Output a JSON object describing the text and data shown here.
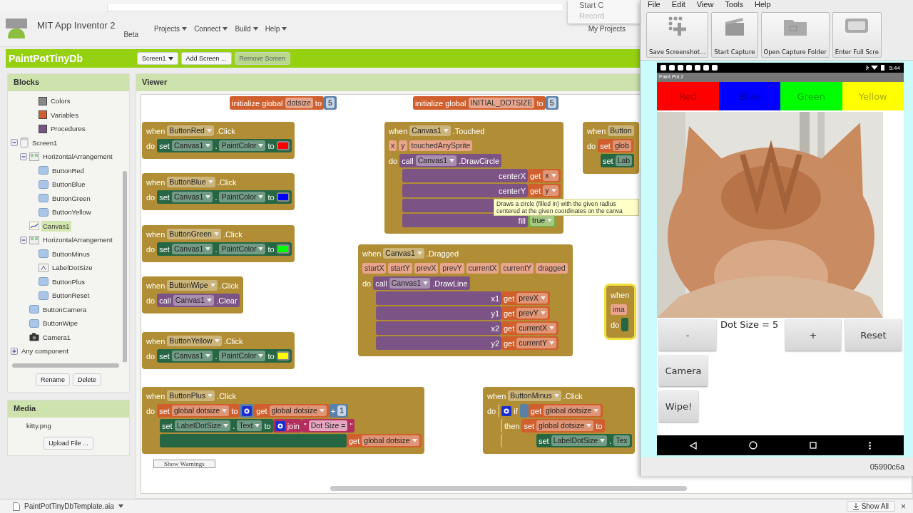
{
  "browser": {
    "menu_items": [
      {
        "label": "Start C",
        "disabled": false
      },
      {
        "label": "Record",
        "disabled": true
      }
    ]
  },
  "header": {
    "app_name": "MIT App Inventor 2",
    "edition": "Beta",
    "menus": [
      "Projects",
      "Connect",
      "Build",
      "Help"
    ],
    "my_projects": "My Projects"
  },
  "project_bar": {
    "project": "PaintPotTinyDb",
    "buttons": [
      {
        "label": "Screen1",
        "kind": "dropdown",
        "disabled": false
      },
      {
        "label": "Add Screen ...",
        "kind": "plain",
        "disabled": false
      },
      {
        "label": "Remove Screen",
        "kind": "plain",
        "disabled": true
      }
    ]
  },
  "blocks_panel": {
    "title": "Blocks",
    "tree": [
      {
        "label": "Colors",
        "kind": "builtin",
        "color": "#888888",
        "selected": false
      },
      {
        "label": "Variables",
        "kind": "builtin",
        "color": "#d05f2d",
        "selected": false
      },
      {
        "label": "Procedures",
        "kind": "builtin",
        "color": "#7c5385",
        "selected": false
      },
      {
        "label": "Screen1",
        "kind": "screen",
        "selected": false,
        "expanded": true,
        "children": [
          {
            "label": "HorizontalArrangement",
            "kind": "arrangement",
            "selected": false,
            "expanded": true,
            "children": [
              {
                "label": "ButtonRed",
                "kind": "button",
                "selected": false
              },
              {
                "label": "ButtonBlue",
                "kind": "button",
                "selected": false
              },
              {
                "label": "ButtonGreen",
                "kind": "button",
                "selected": false
              },
              {
                "label": "ButtonYellow",
                "kind": "button",
                "selected": false
              }
            ]
          },
          {
            "label": "Canvas1",
            "kind": "canvas",
            "selected": true
          },
          {
            "label": "HorizontalArrangement",
            "kind": "arrangement",
            "selected": false,
            "expanded": true,
            "children": [
              {
                "label": "ButtonMinus",
                "kind": "button",
                "selected": false
              },
              {
                "label": "LabelDotSize",
                "kind": "label",
                "selected": false
              },
              {
                "label": "ButtonPlus",
                "kind": "button",
                "selected": false
              },
              {
                "label": "ButtonReset",
                "kind": "button",
                "selected": false
              }
            ]
          },
          {
            "label": "ButtonCamera",
            "kind": "button",
            "selected": false
          },
          {
            "label": "ButtonWipe",
            "kind": "button",
            "selected": false
          },
          {
            "label": "Camera1",
            "kind": "camera",
            "selected": false
          }
        ]
      },
      {
        "label": "Any component",
        "kind": "group",
        "selected": false,
        "expanded": false
      }
    ],
    "buttons": [
      "Rename",
      "Delete"
    ]
  },
  "media_panel": {
    "title": "Media",
    "files": [
      "kitty.png"
    ],
    "upload_button": "Upload File ..."
  },
  "viewer": {
    "title": "Viewer",
    "blocks": [
      {
        "kind": "init",
        "selected": false,
        "lines": [
          [
            {
              "kind": "var",
              "chips": [
                {
                  "kind": "word",
                  "text": "initialize global"
                },
                {
                  "kind": "param",
                  "text": "dotsize"
                },
                {
                  "kind": "word",
                  "text": "to"
                }
              ]
            },
            {
              "kind": "math",
              "chips": [
                {
                  "kind": "num",
                  "text": "5"
                }
              ]
            }
          ]
        ]
      },
      {
        "kind": "init",
        "selected": false,
        "lines": [
          [
            {
              "kind": "var",
              "chips": [
                {
                  "kind": "word",
                  "text": "initialize global"
                },
                {
                  "kind": "param",
                  "text": "INITIAL_DOTSIZE"
                },
                {
                  "kind": "word",
                  "text": "to"
                }
              ]
            },
            {
              "kind": "math",
              "chips": [
                {
                  "kind": "num",
                  "text": "5"
                }
              ]
            }
          ]
        ]
      },
      {
        "kind": "event",
        "selected": false,
        "lines": [
          [
            {
              "kind": "event",
              "chips": [
                {
                  "kind": "word",
                  "text": "when"
                },
                {
                  "kind": "dd",
                  "text": "ButtonRed"
                },
                {
                  "kind": "word",
                  "text": ".Click"
                }
              ]
            }
          ],
          [
            {
              "kind": "event",
              "chips": [
                {
                  "kind": "word",
                  "text": "do"
                }
              ]
            },
            {
              "kind": "set",
              "chips": [
                {
                  "kind": "word",
                  "text": "set"
                },
                {
                  "kind": "dd",
                  "text": "Canvas1"
                },
                {
                  "kind": "word",
                  "text": "."
                },
                {
                  "kind": "dd",
                  "text": "PaintColor"
                },
                {
                  "kind": "word",
                  "text": "to"
                },
                {
                  "kind": "swatch",
                  "color": "#ff0000"
                }
              ]
            }
          ]
        ]
      },
      {
        "kind": "event",
        "selected": false,
        "lines": [
          [
            {
              "kind": "event",
              "chips": [
                {
                  "kind": "word",
                  "text": "when"
                },
                {
                  "kind": "dd",
                  "text": "ButtonBlue"
                },
                {
                  "kind": "word",
                  "text": ".Click"
                }
              ]
            }
          ],
          [
            {
              "kind": "event",
              "chips": [
                {
                  "kind": "word",
                  "text": "do"
                }
              ]
            },
            {
              "kind": "set",
              "chips": [
                {
                  "kind": "word",
                  "text": "set"
                },
                {
                  "kind": "dd",
                  "text": "Canvas1"
                },
                {
                  "kind": "word",
                  "text": "."
                },
                {
                  "kind": "dd",
                  "text": "PaintColor"
                },
                {
                  "kind": "word",
                  "text": "to"
                },
                {
                  "kind": "swatch",
                  "color": "#0000ff"
                }
              ]
            }
          ]
        ]
      },
      {
        "kind": "event",
        "selected": false,
        "lines": [
          [
            {
              "kind": "event",
              "chips": [
                {
                  "kind": "word",
                  "text": "when"
                },
                {
                  "kind": "dd",
                  "text": "ButtonGreen"
                },
                {
                  "kind": "word",
                  "text": ".Click"
                }
              ]
            }
          ],
          [
            {
              "kind": "event",
              "chips": [
                {
                  "kind": "word",
                  "text": "do"
                }
              ]
            },
            {
              "kind": "set",
              "chips": [
                {
                  "kind": "word",
                  "text": "set"
                },
                {
                  "kind": "dd",
                  "text": "Canvas1"
                },
                {
                  "kind": "word",
                  "text": "."
                },
                {
                  "kind": "dd",
                  "text": "PaintColor"
                },
                {
                  "kind": "word",
                  "text": "to"
                },
                {
                  "kind": "swatch",
                  "color": "#00ff00"
                }
              ]
            }
          ]
        ]
      },
      {
        "kind": "event",
        "selected": false,
        "lines": [
          [
            {
              "kind": "event",
              "chips": [
                {
                  "kind": "word",
                  "text": "when"
                },
                {
                  "kind": "dd",
                  "text": "ButtonWipe"
                },
                {
                  "kind": "word",
                  "text": ".Click"
                }
              ]
            }
          ],
          [
            {
              "kind": "event",
              "chips": [
                {
                  "kind": "word",
                  "text": "do"
                }
              ]
            },
            {
              "kind": "call",
              "chips": [
                {
                  "kind": "word",
                  "text": "call"
                },
                {
                  "kind": "dd",
                  "text": "Canvas1"
                },
                {
                  "kind": "word",
                  "text": ".Clear"
                }
              ]
            }
          ]
        ]
      },
      {
        "kind": "event",
        "selected": false,
        "lines": [
          [
            {
              "kind": "event",
              "chips": [
                {
                  "kind": "word",
                  "text": "when"
                },
                {
                  "kind": "dd",
                  "text": "ButtonYellow"
                },
                {
                  "kind": "word",
                  "text": ".Click"
                }
              ]
            }
          ],
          [
            {
              "kind": "event",
              "chips": [
                {
                  "kind": "word",
                  "text": "do"
                }
              ]
            },
            {
              "kind": "set",
              "chips": [
                {
                  "kind": "word",
                  "text": "set"
                },
                {
                  "kind": "dd",
                  "text": "Canvas1"
                },
                {
                  "kind": "word",
                  "text": "."
                },
                {
                  "kind": "dd",
                  "text": "PaintColor"
                },
                {
                  "kind": "word",
                  "text": "to"
                },
                {
                  "kind": "swatch",
                  "color": "#ffff00"
                }
              ]
            }
          ]
        ]
      },
      {
        "kind": "event",
        "selected": false,
        "lines": [
          [
            {
              "kind": "event",
              "chips": [
                {
                  "kind": "word",
                  "text": "when"
                },
                {
                  "kind": "dd",
                  "text": "Canvas1"
                },
                {
                  "kind": "word",
                  "text": ".Touched"
                }
              ]
            }
          ],
          [
            {
              "kind": "event",
              "chips": [
                {
                  "kind": "param",
                  "text": "x"
                },
                {
                  "kind": "param",
                  "text": "y"
                },
                {
                  "kind": "param",
                  "text": "touchedAnySprite"
                }
              ]
            }
          ],
          [
            {
              "kind": "event",
              "chips": [
                {
                  "kind": "word",
                  "text": "do"
                }
              ]
            },
            {
              "kind": "call",
              "chips": [
                {
                  "kind": "word",
                  "text": "call"
                },
                {
                  "kind": "dd",
                  "text": "Canvas1"
                },
                {
                  "kind": "word",
                  "text": ".DrawCircle"
                }
              ]
            }
          ],
          [
            {
              "kind": "arg",
              "chips": [
                {
                  "kind": "word",
                  "text": "centerX"
                }
              ]
            },
            {
              "kind": "get",
              "chips": [
                {
                  "kind": "word",
                  "text": "get"
                },
                {
                  "kind": "dd",
                  "text": "x"
                }
              ]
            }
          ],
          [
            {
              "kind": "arg",
              "chips": [
                {
                  "kind": "word",
                  "text": "centerY"
                }
              ]
            },
            {
              "kind": "get",
              "chips": [
                {
                  "kind": "word",
                  "text": "get"
                },
                {
                  "kind": "dd",
                  "text": "y"
                }
              ]
            }
          ],
          [
            {
              "kind": "arg"
            }
          ],
          [
            {
              "kind": "arg",
              "chips": [
                {
                  "kind": "word",
                  "text": "fill"
                }
              ]
            },
            {
              "kind": "logic",
              "chips": [
                {
                  "kind": "dd",
                  "text": "true"
                }
              ]
            }
          ]
        ]
      },
      {
        "kind": "event",
        "selected": false,
        "lines": [
          [
            {
              "kind": "event",
              "chips": [
                {
                  "kind": "word",
                  "text": "when"
                },
                {
                  "kind": "field",
                  "text": "Button"
                }
              ]
            }
          ],
          [
            {
              "kind": "event",
              "chips": [
                {
                  "kind": "word",
                  "text": "do"
                }
              ]
            },
            {
              "kind": "varset",
              "chips": [
                {
                  "kind": "word",
                  "text": "set"
                },
                {
                  "kind": "field",
                  "text": "glob"
                }
              ]
            }
          ],
          [
            {
              "kind": "set",
              "chips": [
                {
                  "kind": "word",
                  "text": "set"
                },
                {
                  "kind": "field",
                  "text": "Lab"
                }
              ]
            }
          ]
        ]
      },
      {
        "kind": "event",
        "selected": false,
        "lines": [
          [
            {
              "kind": "event",
              "chips": [
                {
                  "kind": "word",
                  "text": "when"
                },
                {
                  "kind": "dd",
                  "text": "Canvas1"
                },
                {
                  "kind": "word",
                  "text": ".Dragged"
                }
              ]
            }
          ],
          [
            {
              "kind": "event",
              "chips": [
                {
                  "kind": "param",
                  "text": "startX"
                },
                {
                  "kind": "param",
                  "text": "startY"
                },
                {
                  "kind": "param",
                  "text": "prevX"
                },
                {
                  "kind": "param",
                  "text": "prevY"
                },
                {
                  "kind": "param",
                  "text": "currentX"
                },
                {
                  "kind": "param",
                  "text": "currentY"
                },
                {
                  "kind": "param",
                  "text": "dragged"
                }
              ]
            }
          ],
          [
            {
              "kind": "event",
              "chips": [
                {
                  "kind": "word",
                  "text": "do"
                }
              ]
            },
            {
              "kind": "call",
              "chips": [
                {
                  "kind": "word",
                  "text": "call"
                },
                {
                  "kind": "dd",
                  "text": "Canvas1"
                },
                {
                  "kind": "word",
                  "text": ".DrawLine"
                }
              ]
            }
          ],
          [
            {
              "kind": "arg",
              "chips": [
                {
                  "kind": "word",
                  "text": "x1"
                }
              ]
            },
            {
              "kind": "get",
              "chips": [
                {
                  "kind": "word",
                  "text": "get"
                },
                {
                  "kind": "dd",
                  "text": "prevX"
                }
              ]
            }
          ],
          [
            {
              "kind": "arg",
              "chips": [
                {
                  "kind": "word",
                  "text": "y1"
                }
              ]
            },
            {
              "kind": "get",
              "chips": [
                {
                  "kind": "word",
                  "text": "get"
                },
                {
                  "kind": "dd",
                  "text": "prevY"
                }
              ]
            }
          ],
          [
            {
              "kind": "arg",
              "chips": [
                {
                  "kind": "word",
                  "text": "x2"
                }
              ]
            },
            {
              "kind": "get",
              "chips": [
                {
                  "kind": "word",
                  "text": "get"
                },
                {
                  "kind": "dd",
                  "text": "currentX"
                }
              ]
            }
          ],
          [
            {
              "kind": "arg",
              "chips": [
                {
                  "kind": "word",
                  "text": "y2"
                }
              ]
            },
            {
              "kind": "get",
              "chips": [
                {
                  "kind": "word",
                  "text": "get"
                },
                {
                  "kind": "dd",
                  "text": "currentY"
                }
              ]
            }
          ]
        ]
      },
      {
        "kind": "event",
        "selected": true,
        "lines": [
          [
            {
              "kind": "event",
              "chips": [
                {
                  "kind": "word",
                  "text": "when"
                }
              ]
            }
          ],
          [
            {
              "kind": "event",
              "chips": [
                {
                  "kind": "param",
                  "text": "ima"
                }
              ]
            }
          ],
          [
            {
              "kind": "event",
              "chips": [
                {
                  "kind": "word",
                  "text": "do"
                }
              ]
            },
            {
              "kind": "set"
            }
          ]
        ]
      },
      {
        "kind": "event",
        "selected": false,
        "lines": [
          [
            {
              "kind": "event",
              "chips": [
                {
                  "kind": "word",
                  "text": "when"
                },
                {
                  "kind": "dd",
                  "text": "ButtonPlus"
                },
                {
                  "kind": "word",
                  "text": ".Click"
                }
              ]
            }
          ],
          [
            {
              "kind": "event",
              "chips": [
                {
                  "kind": "word",
                  "text": "do"
                }
              ]
            },
            {
              "kind": "varset",
              "chips": [
                {
                  "kind": "word",
                  "text": "set"
                },
                {
                  "kind": "dd",
                  "text": "global dotsize"
                },
                {
                  "kind": "word",
                  "text": "to"
                }
              ]
            },
            {
              "kind": "math",
              "chips": [
                {
                  "kind": "gear"
                }
              ]
            },
            {
              "kind": "get",
              "chips": [
                {
                  "kind": "word",
                  "text": "get"
                },
                {
                  "kind": "dd",
                  "text": "global dotsize"
                }
              ]
            },
            {
              "kind": "math",
              "chips": [
                {
                  "kind": "word",
                  "text": "+"
                },
                {
                  "kind": "num",
                  "text": "1"
                }
              ]
            }
          ],
          [
            {
              "kind": "set",
              "chips": [
                {
                  "kind": "word",
                  "text": "set"
                },
                {
                  "kind": "dd",
                  "text": "LabelDotSize"
                },
                {
                  "kind": "word",
                  "text": "."
                },
                {
                  "kind": "dd",
                  "text": "Text"
                },
                {
                  "kind": "word",
                  "text": "to"
                }
              ]
            },
            {
              "kind": "text",
              "chips": [
                {
                  "kind": "gear"
                },
                {
                  "kind": "word",
                  "text": "join"
                }
              ]
            },
            {
              "kind": "text",
              "chips": [
                {
                  "kind": "word",
                  "text": "\""
                },
                {
                  "kind": "str",
                  "text": "Dot Size ="
                },
                {
                  "kind": "word",
                  "text": "\""
                }
              ]
            }
          ],
          [
            {
              "kind": "set"
            },
            {
              "kind": "get",
              "chips": [
                {
                  "kind": "word",
                  "text": "get"
                },
                {
                  "kind": "dd",
                  "text": "global dotsize"
                }
              ]
            }
          ]
        ]
      },
      {
        "kind": "event",
        "selected": false,
        "lines": [
          [
            {
              "kind": "event",
              "chips": [
                {
                  "kind": "word",
                  "text": "when"
                },
                {
                  "kind": "dd",
                  "text": "ButtonMinus"
                },
                {
                  "kind": "word",
                  "text": ".Click"
                }
              ]
            }
          ],
          [
            {
              "kind": "event",
              "chips": [
                {
                  "kind": "word",
                  "text": "do"
                }
              ]
            },
            {
              "kind": "clause",
              "chips": [
                {
                  "kind": "gear"
                },
                {
                  "kind": "word",
                  "text": "if"
                }
              ]
            },
            {
              "kind": "math"
            },
            {
              "kind": "get",
              "chips": [
                {
                  "kind": "word",
                  "text": "get"
                },
                {
                  "kind": "dd",
                  "text": "global dotsize"
                }
              ]
            }
          ],
          [
            {
              "kind": "clause",
              "chips": [
                {
                  "kind": "word",
                  "text": "then"
                }
              ]
            },
            {
              "kind": "varset",
              "chips": [
                {
                  "kind": "word",
                  "text": "set"
                },
                {
                  "kind": "dd",
                  "text": "global dotsize"
                },
                {
                  "kind": "word",
                  "text": "to"
                }
              ]
            }
          ],
          [
            {
              "kind": "clause"
            },
            {
              "kind": "set",
              "chips": [
                {
                  "kind": "word",
                  "text": "set"
                },
                {
                  "kind": "dd",
                  "text": "LabelDotSize"
                },
                {
                  "kind": "word",
                  "text": "."
                },
                {
                  "kind": "field",
                  "text": "Tex"
                }
              ]
            }
          ]
        ]
      }
    ],
    "tooltip": "Draws a circle (filled in) with the given radius centered at the given coordinates on the canva",
    "warnings_button": "Show Warnings"
  },
  "emulator": {
    "menus": [
      "File",
      "Edit",
      "View",
      "Tools",
      "Help"
    ],
    "tools": [
      {
        "label": "Save Screenshot...",
        "kind": "screenshot"
      },
      {
        "label": "Start Capture",
        "kind": "capture"
      },
      {
        "label": "Open Capture Folder",
        "kind": "folder"
      },
      {
        "label": "Enter Full Scre",
        "kind": "fullscreen"
      }
    ],
    "device": {
      "time": "5:44",
      "app_title": "Paint Pot 2",
      "color_buttons": [
        {
          "label": "Red",
          "color": "#ff0000"
        },
        {
          "label": "Blue",
          "color": "#0000ff"
        },
        {
          "label": "Green",
          "color": "#00ff00"
        },
        {
          "label": "Yellow",
          "color": "#ffff00"
        }
      ],
      "canvas": {
        "kind": "picture"
      },
      "dot_size": "Dot Size = 5",
      "minus": "-",
      "plus": "+",
      "reset": "Reset",
      "buttons": [
        "Camera",
        "Wipe!"
      ]
    },
    "device_id": "05990c6a"
  },
  "downloads": {
    "file": "PaintPotTinyDbTemplate.aia",
    "show_all": "Show All",
    "close": "×"
  }
}
